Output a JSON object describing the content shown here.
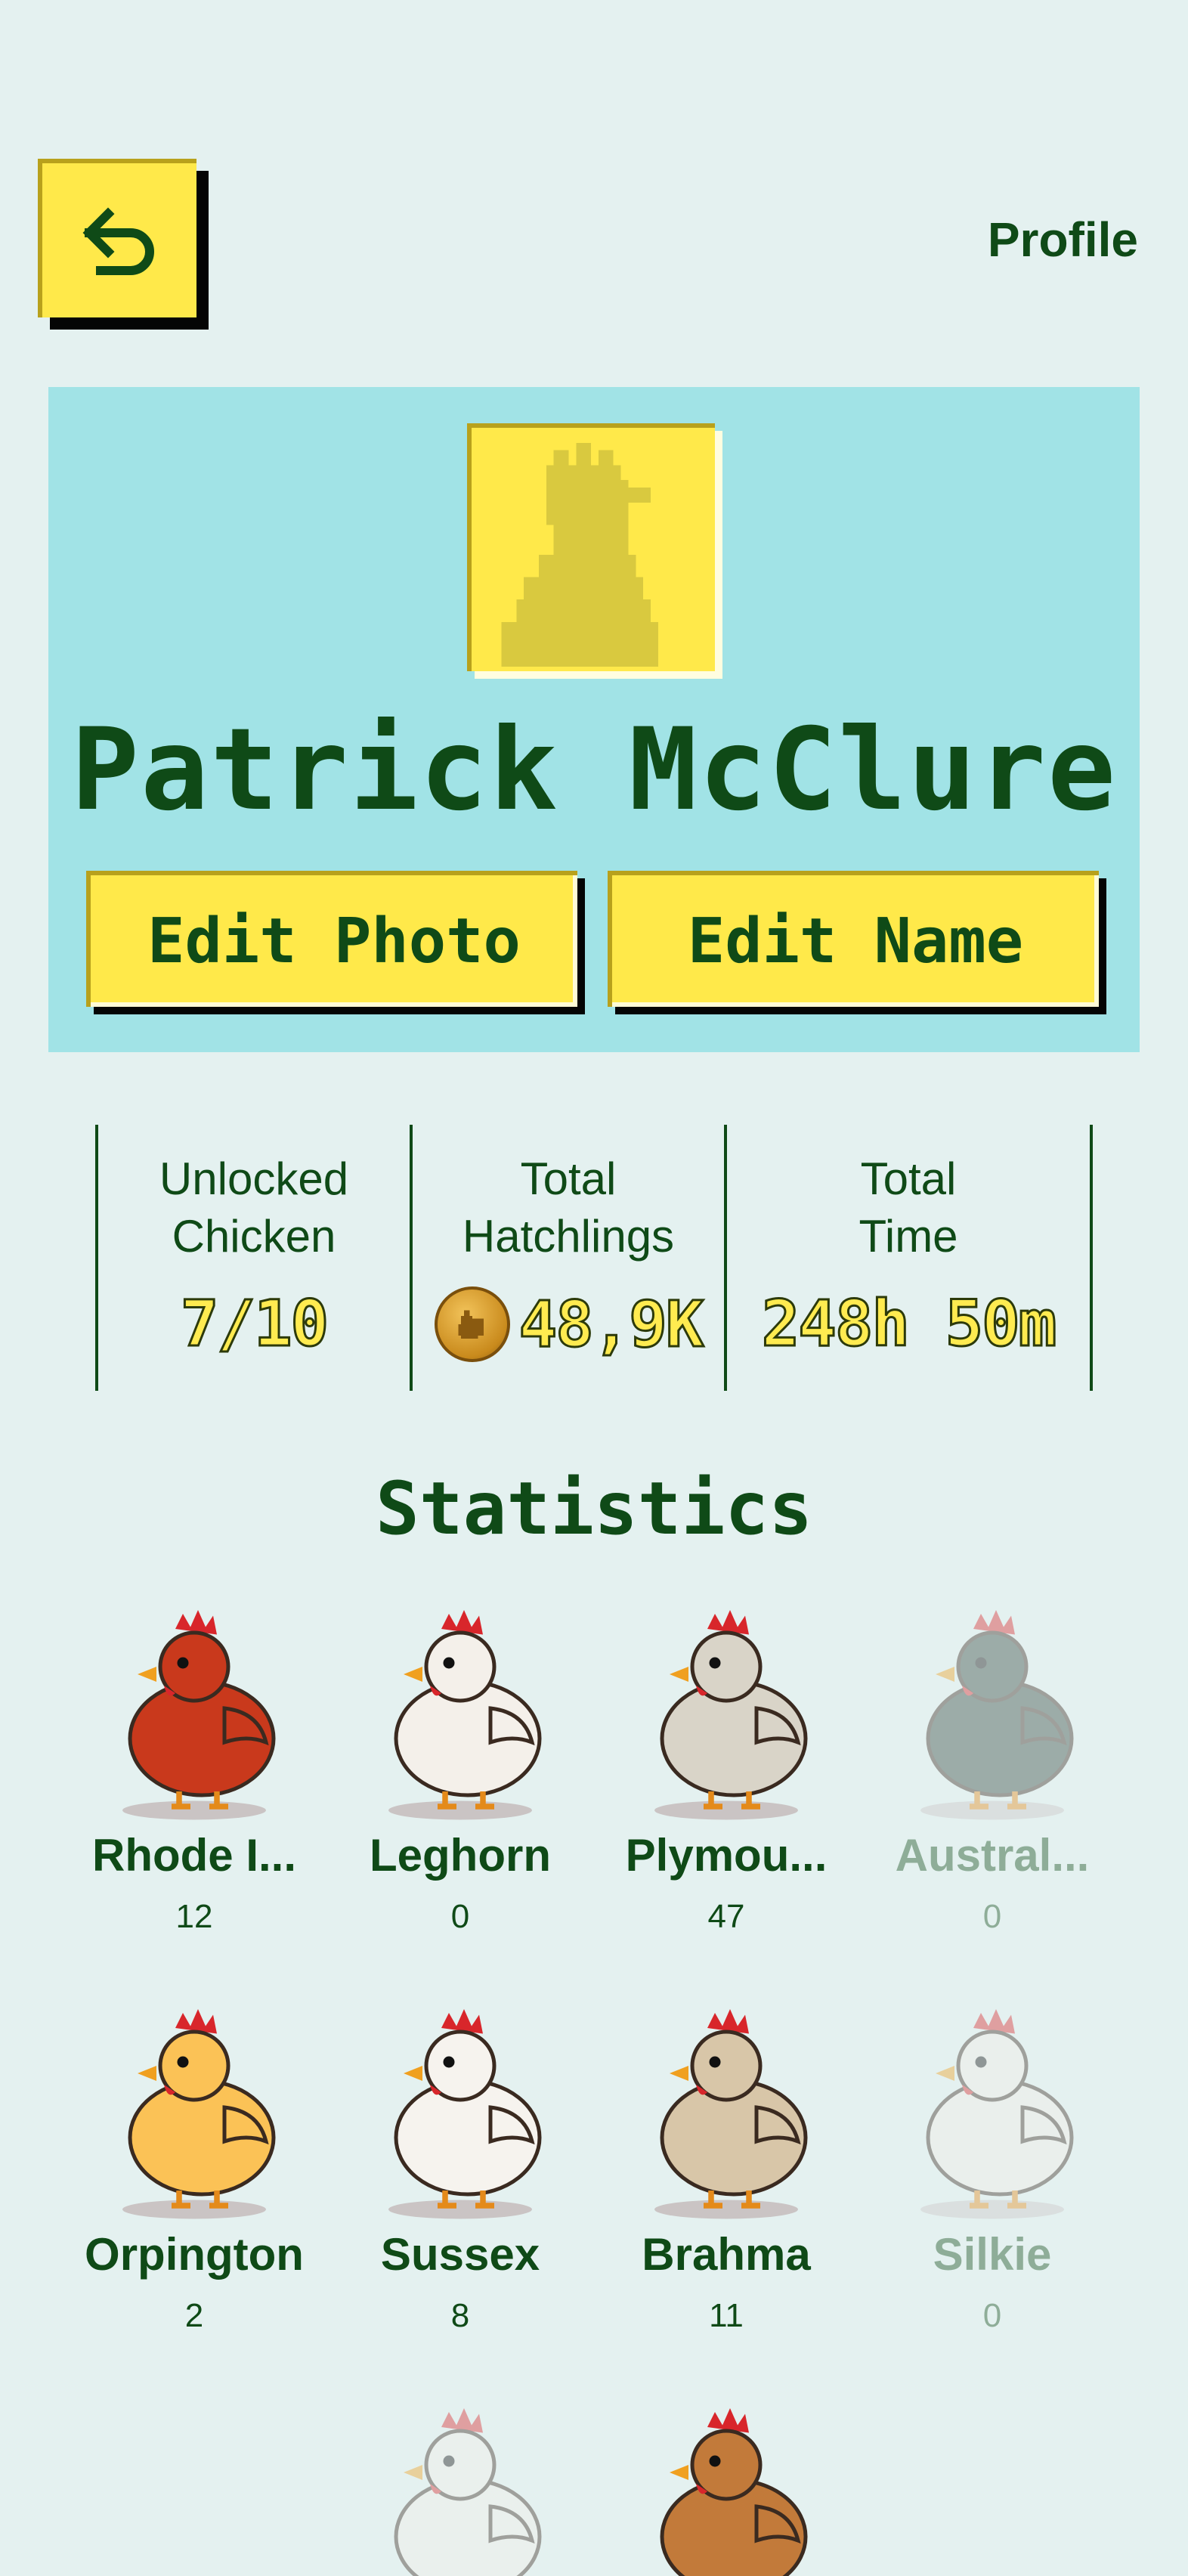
{
  "header": {
    "title": "Profile",
    "back_icon": "undo-arrow-icon"
  },
  "profile": {
    "name": "Patrick McClure",
    "avatar_icon": "chicken-silhouette-icon",
    "edit_photo_label": "Edit Photo",
    "edit_name_label": "Edit Name"
  },
  "stats": {
    "unlocked": {
      "label": "Unlocked\nChicken",
      "value": "7/10"
    },
    "hatchlings": {
      "label": "Total\nHatchlings",
      "value": "48,9K",
      "icon": "chicken-coin-icon"
    },
    "time": {
      "label": "Total\nTime",
      "value": "248h 50m"
    }
  },
  "statistics_title": "Statistics",
  "chickens": [
    {
      "name": "Rhode I...",
      "count": "12",
      "locked": false,
      "icon": "rhode-island-red-chicken-icon",
      "color": "#c9391c"
    },
    {
      "name": "Leghorn",
      "count": "0",
      "locked": false,
      "icon": "leghorn-chicken-icon",
      "color": "#f4f0ea"
    },
    {
      "name": "Plymou...",
      "count": "47",
      "locked": false,
      "icon": "plymouth-rock-chicken-icon",
      "color": "#d9d4c8"
    },
    {
      "name": "Austral...",
      "count": "0",
      "locked": true,
      "icon": "australorp-chicken-icon",
      "color": "#33463e"
    },
    {
      "name": "Orpington",
      "count": "2",
      "locked": false,
      "icon": "orpington-chick-icon",
      "color": "#fbc256"
    },
    {
      "name": "Sussex",
      "count": "8",
      "locked": false,
      "icon": "sussex-chicken-icon",
      "color": "#f6f3ee"
    },
    {
      "name": "Brahma",
      "count": "11",
      "locked": false,
      "icon": "brahma-rooster-icon",
      "color": "#d8c6a8"
    },
    {
      "name": "Silkie",
      "count": "0",
      "locked": true,
      "icon": "silkie-chicken-icon",
      "color": "#f3eee7"
    },
    {
      "name": "",
      "count": "",
      "locked": true,
      "icon": "white-chicken-icon",
      "color": "#f3efe9"
    },
    {
      "name": "",
      "count": "",
      "locked": false,
      "icon": "brown-hen-icon",
      "color": "#c27a3a"
    }
  ]
}
